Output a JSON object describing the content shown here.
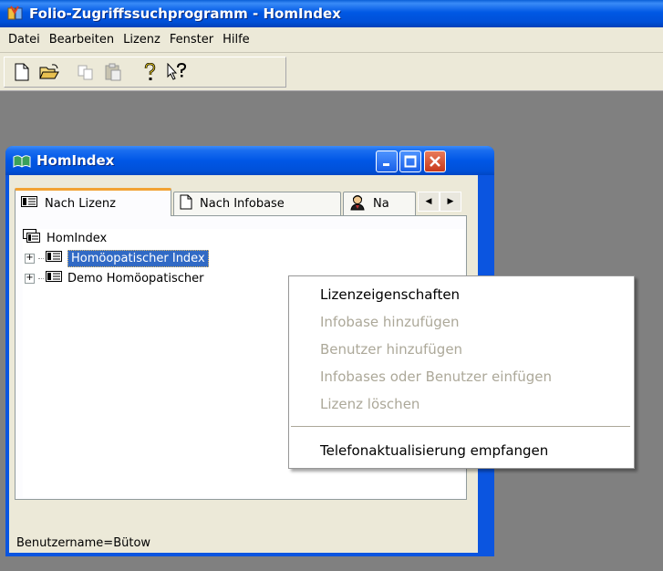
{
  "app": {
    "title": "Folio-Zugriffssuchprogramm - HomIndex",
    "accent_color": "#0054e3"
  },
  "menubar": {
    "items": [
      "Datei",
      "Bearbeiten",
      "Lizenz",
      "Fenster",
      "Hilfe"
    ]
  },
  "toolbar": {
    "buttons": [
      "new-file-icon",
      "open-folder-icon",
      "copy-icon",
      "paste-icon",
      "help-icon",
      "context-help-icon"
    ]
  },
  "child_window": {
    "title": "HomIndex",
    "tabs": [
      {
        "label": "Nach Lizenz",
        "icon": "license-icon",
        "active": true
      },
      {
        "label": "Nach Infobase",
        "icon": "document-icon",
        "active": false
      },
      {
        "label": "Na",
        "icon": "user-icon",
        "active": false
      }
    ],
    "tree": {
      "root": "HomIndex",
      "children": [
        {
          "label": "Homöopatischer Index",
          "selected": true
        },
        {
          "label": "Demo Homöopatischer",
          "selected": false
        }
      ]
    },
    "status": "Benutzername=Bütow"
  },
  "context_menu": {
    "items": [
      {
        "label": "Lizenzeigenschaften",
        "enabled": true
      },
      {
        "label": "Infobase hinzufügen",
        "enabled": false
      },
      {
        "label": "Benutzer hinzufügen",
        "enabled": false
      },
      {
        "label": "Infobases oder Benutzer einfügen",
        "enabled": false
      },
      {
        "label": "Lizenz löschen",
        "enabled": false
      },
      {
        "label": "Telefonaktualisierung empfangen",
        "enabled": true
      }
    ]
  }
}
